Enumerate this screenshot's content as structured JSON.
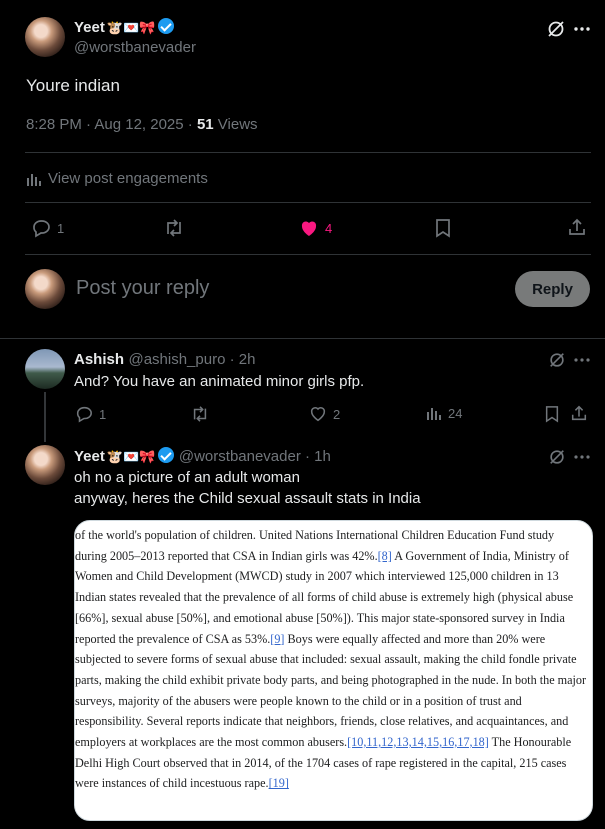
{
  "main_post": {
    "author_name": "Yeet",
    "author_emojis": "🐮💌🎀",
    "author_handle": "@worstbanevader",
    "text": "Youre indian",
    "timestamp": "8:28 PM · Aug 12, 2025 · ",
    "views_count": "51",
    "views_label": " Views",
    "engagements_label": "View post engagements",
    "actions": {
      "replies": "1",
      "likes": "4"
    }
  },
  "compose": {
    "placeholder": "Post your reply",
    "reply_button": "Reply"
  },
  "replies": [
    {
      "author_name": "Ashish",
      "author_handle": "@ashish_puro",
      "time": " · 2h",
      "text": "And? You have an animated minor girls pfp.",
      "actions": {
        "replies": "1",
        "likes": "2",
        "views": "24"
      }
    },
    {
      "author_name": "Yeet",
      "author_emojis": "🐮💌🎀",
      "author_handle": "@worstbanevader",
      "time": " · 1h",
      "text_line1": "oh no a picture of an adult woman",
      "text_line2": "anyway, heres the Child sexual assault stats in India",
      "image_text": {
        "p1": "of the world's population of children. United Nations International Children Education Fund study during 2005–2013 reported that CSA in Indian girls was 42%.",
        "ref8": "[8]",
        "p2": " A Government of India, Ministry of Women and Child Development (MWCD) study in 2007 which interviewed 125,000 children in 13 Indian states revealed that the prevalence of all forms of child abuse is extremely high (physical abuse [66%], sexual abuse [50%], and emotional abuse [50%]). This major state-sponsored survey in India reported the prevalence of CSA as 53%.",
        "ref9": "[9]",
        "p3": " Boys were equally affected and more than 20% were subjected to severe forms of sexual abuse that included: sexual assault, making the child fondle private parts, making the child exhibit private body parts, and being photographed in the nude. In both the major surveys, majority of the abusers were people known to the child or in a position of trust and responsibility. Several reports indicate that neighbors, friends, close relatives, and acquaintances, and employers at workplaces are the most common abusers.",
        "ref10": "[10,11,12,13,14,15,16,17,18]",
        "p4": " The Honourable Delhi High Court observed that in 2014, of the 1704 cases of rape registered in the capital, 215 cases were instances of child incestuous rape.",
        "ref19": "[19]"
      }
    }
  ],
  "colors": {
    "like": "#f91880",
    "link": "#3366cc",
    "verified": "#1d9bf0"
  }
}
